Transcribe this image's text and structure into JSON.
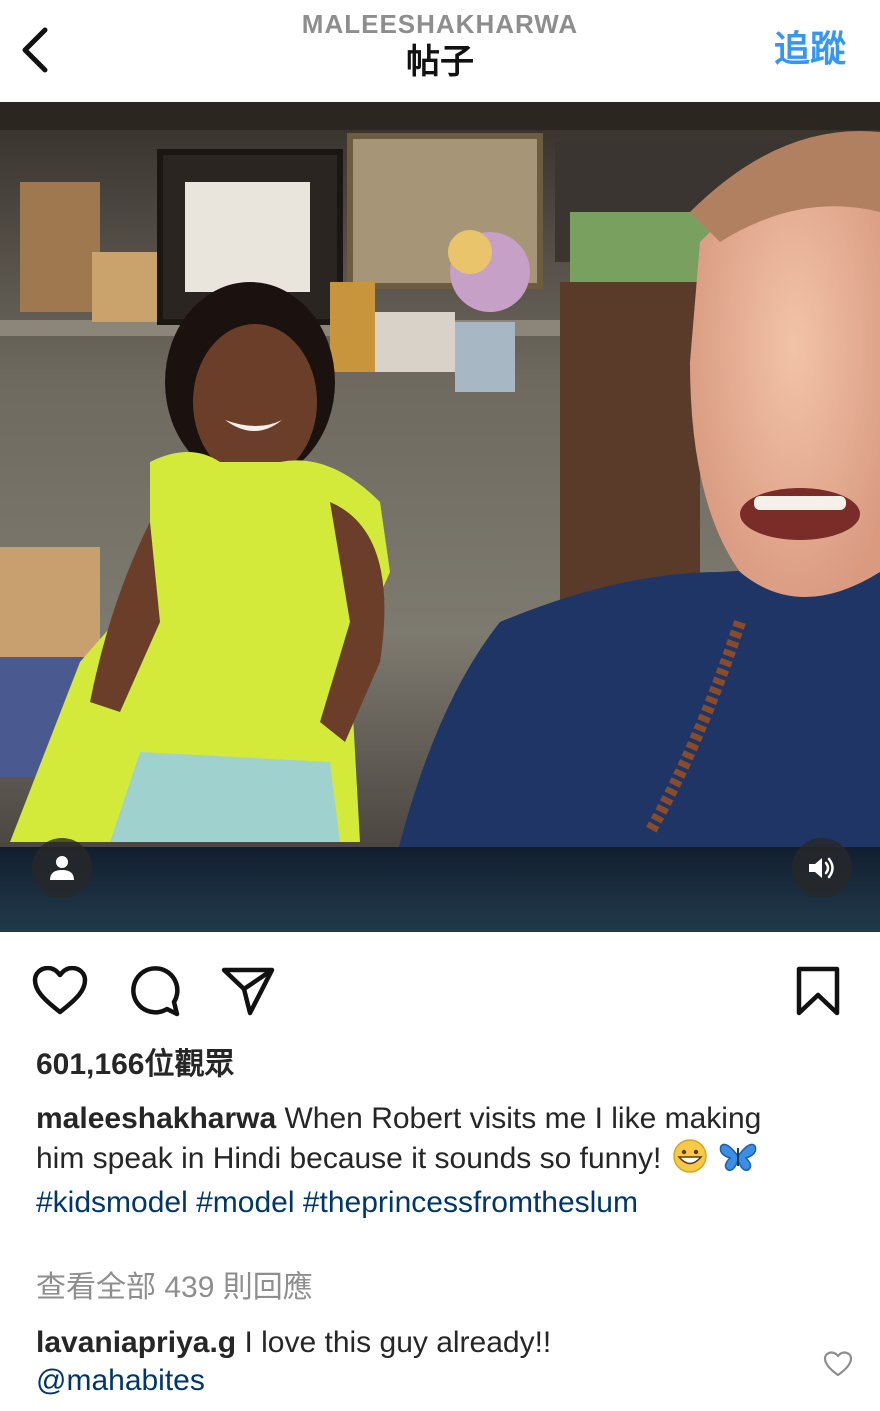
{
  "header": {
    "username": "MALEESHAKHARWA",
    "subtitle": "帖子",
    "follow_label": "追蹤"
  },
  "post": {
    "views": "601,166位觀眾",
    "caption": {
      "username": "maleeshakharwa",
      "text": " When Robert visits me I like making him speak in Hindi because it sounds so funny! ",
      "emojis": [
        "grinning-face",
        "butterfly"
      ],
      "hashtags": [
        "#kidsmodel",
        "#model",
        "#theprincessfromtheslum"
      ]
    },
    "view_comments_label": "查看全部 439 則回應",
    "comment": {
      "username": "lavaniapriya.g",
      "text": " I love this guy already!!",
      "mention": "@mahabites"
    }
  },
  "icons": {
    "back": "chevron-left-icon",
    "user_tag": "person-icon",
    "sound": "speaker-icon",
    "like": "heart-icon",
    "comment": "comment-bubble-icon",
    "share": "paper-plane-icon",
    "save": "bookmark-icon",
    "comment_like": "small-heart-icon"
  },
  "colors": {
    "follow_blue": "#3797f0",
    "hashtag_blue": "#00376b",
    "muted_gray": "#8e8e8e"
  }
}
